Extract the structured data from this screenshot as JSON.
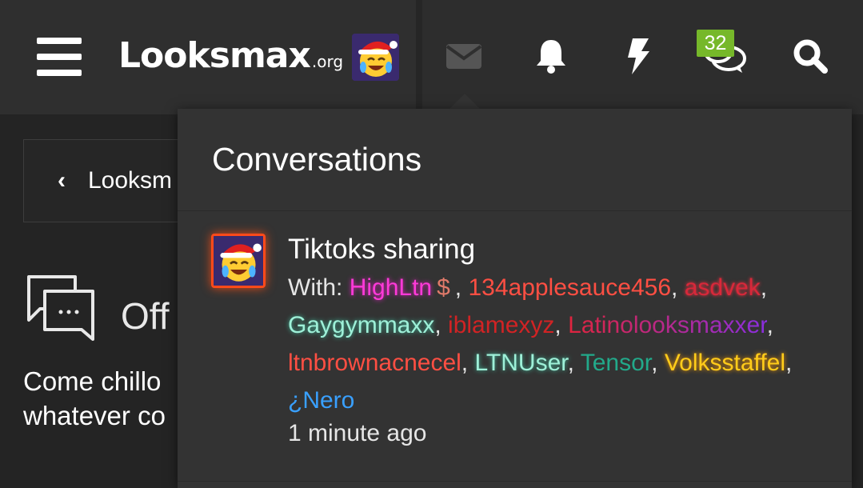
{
  "header": {
    "logo_main": "Looksmax",
    "logo_tld": ".org",
    "icons": {
      "menu": "hamburger-menu-icon",
      "avatar": "emoji-avatar",
      "inbox": "envelope-icon",
      "alerts": "bell-icon",
      "whats_new": "lightning-icon",
      "chat": "chat-bubbles-icon",
      "search": "search-icon"
    },
    "chat_badge": "32"
  },
  "background_page": {
    "breadcrumb": "Looksm",
    "forum_title": "Off",
    "forum_desc_line1": "Come chillo",
    "forum_desc_line2": "whatever co"
  },
  "conversations_popup": {
    "title": "Conversations",
    "items": [
      {
        "title": "Tiktoks sharing",
        "with_label": "With:",
        "participants": [
          "HighLtn",
          "134applesauce456",
          "asdvek",
          "Gaygymmaxx",
          "iblamexyz",
          "Latinolooksmaxxer",
          "ltnbrownacnecel",
          "LTNUser",
          "Tensor",
          "Volksstaffel",
          "¿Nero"
        ],
        "time": "1 minute ago"
      }
    ]
  },
  "colors": {
    "background": "#242424",
    "topbar": "#2d2d2d",
    "popup": "#333333",
    "badge": "#76b82a",
    "avatar_ring": "#ff4a1a"
  }
}
